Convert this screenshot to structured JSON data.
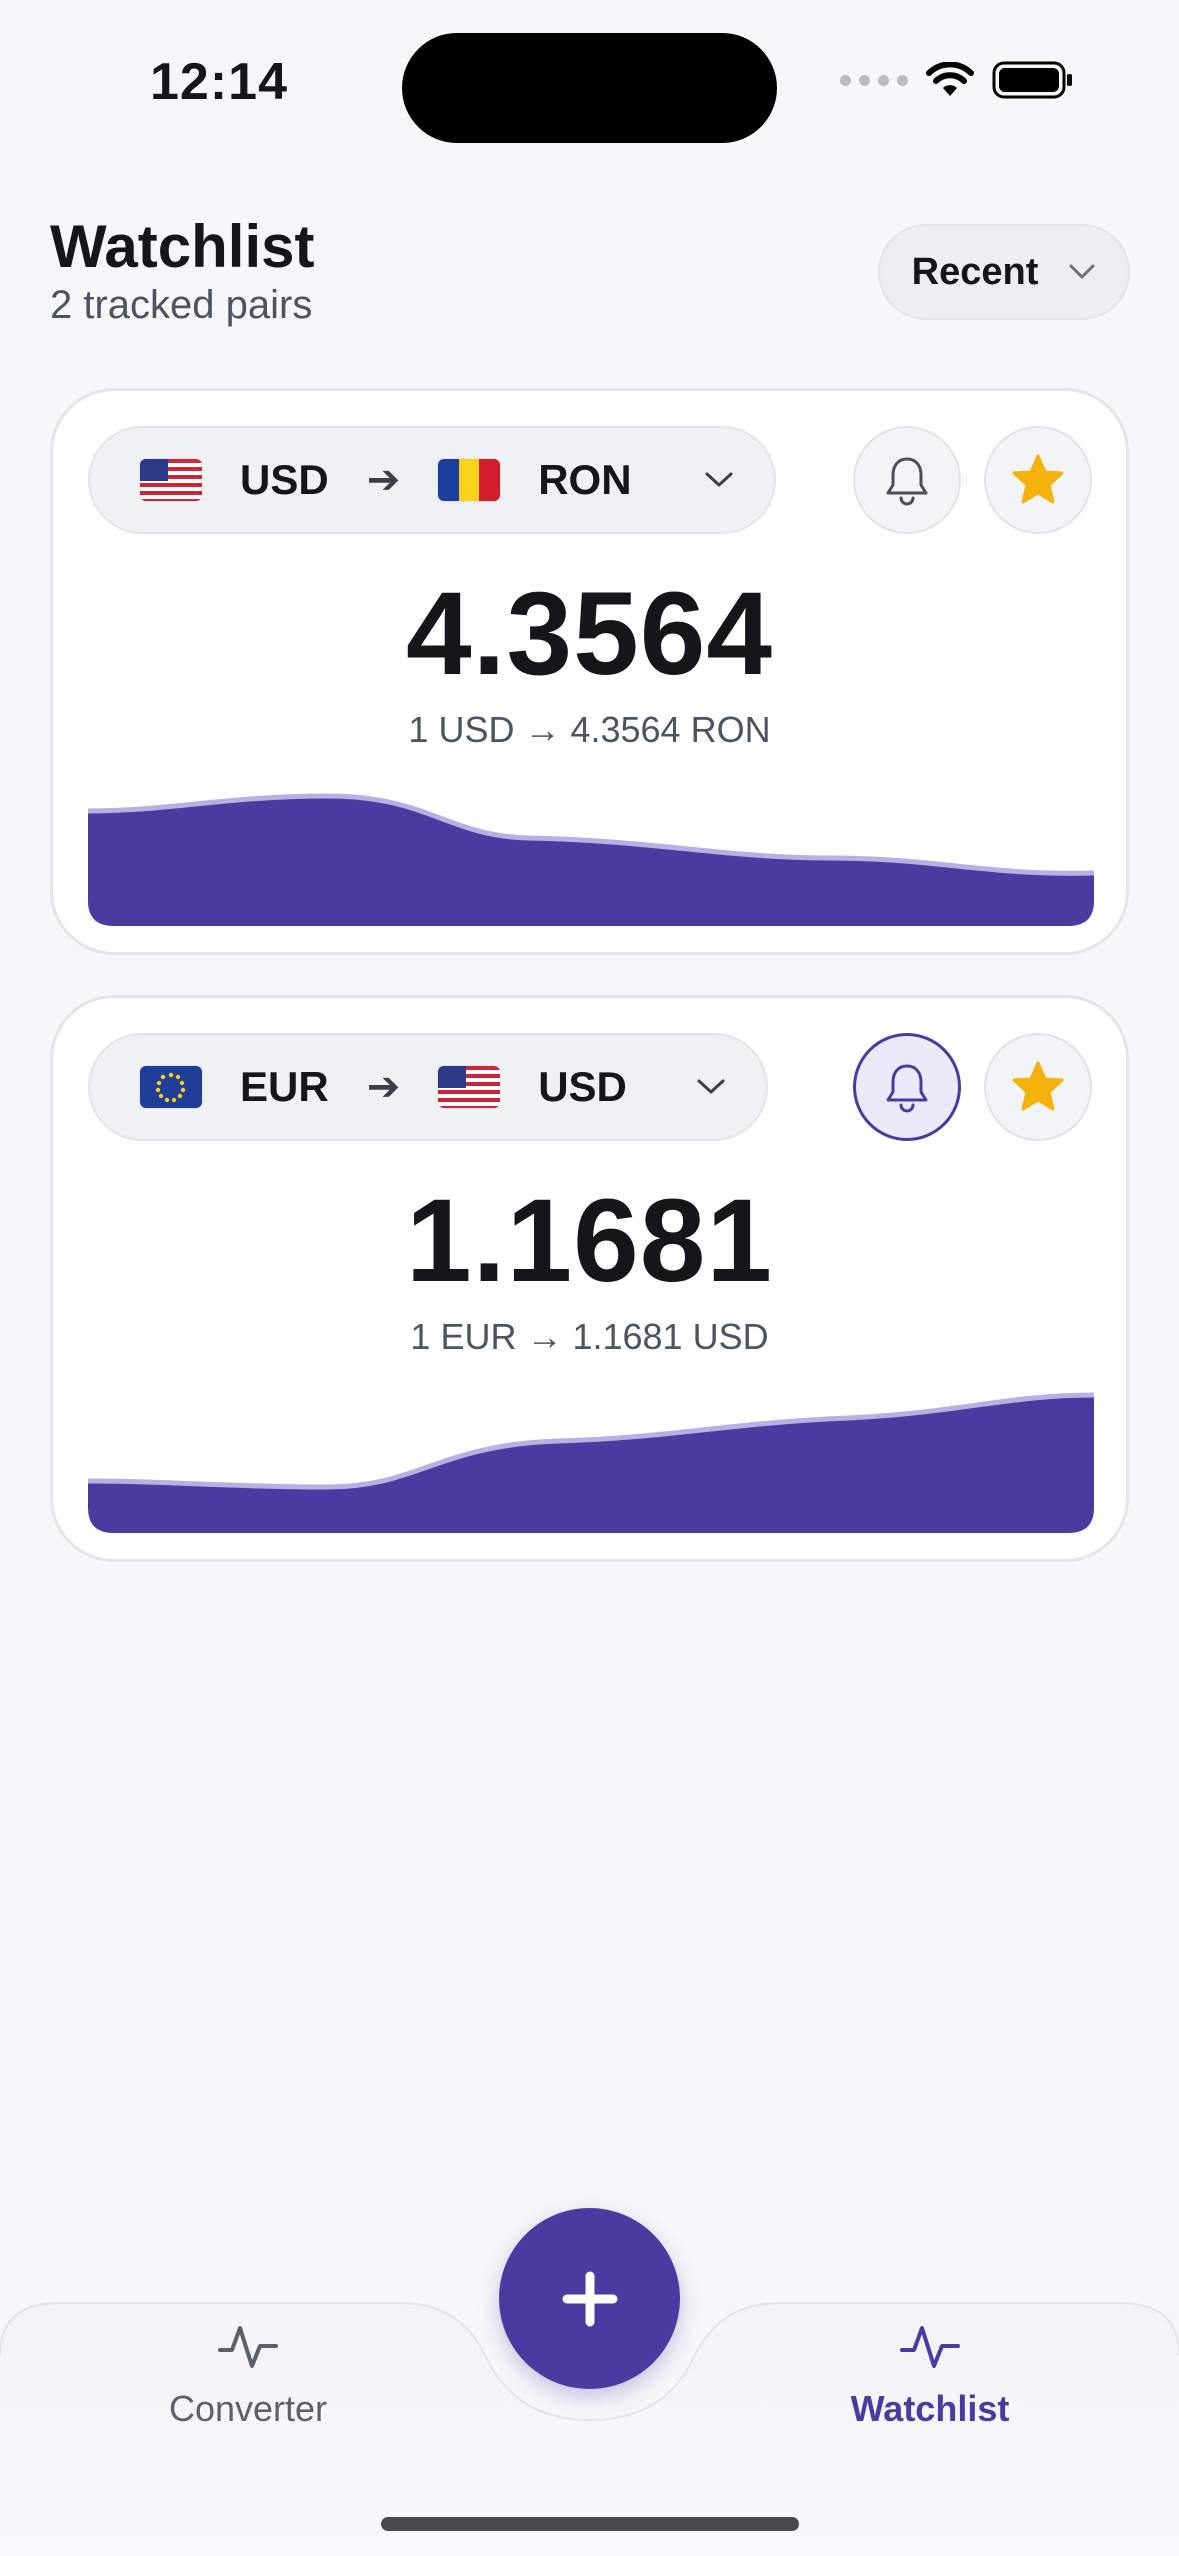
{
  "status_bar": {
    "time": "12:14"
  },
  "header": {
    "title": "Watchlist",
    "subtitle": "2 tracked pairs",
    "sort_label": "Recent"
  },
  "cards": [
    {
      "from_code": "USD",
      "to_code": "RON",
      "from_flag": "us-flag",
      "to_flag": "ro-flag",
      "rate": "4.3564",
      "rate_detail": "1 USD → 4.3564 RON",
      "alert_active": false,
      "favorite": true,
      "trend": "down"
    },
    {
      "from_code": "EUR",
      "to_code": "USD",
      "from_flag": "eu-flag",
      "to_flag": "us-flag",
      "rate": "1.1681",
      "rate_detail": "1 EUR → 1.1681 USD",
      "alert_active": true,
      "favorite": true,
      "trend": "up"
    }
  ],
  "tabbar": {
    "converter_label": "Converter",
    "watchlist_label": "Watchlist",
    "active_tab": "Watchlist",
    "fab_icon": "plus-icon"
  },
  "colors": {
    "accent": "#4b3aa0",
    "star": "#f5b20b",
    "background": "#f6f7f9"
  }
}
